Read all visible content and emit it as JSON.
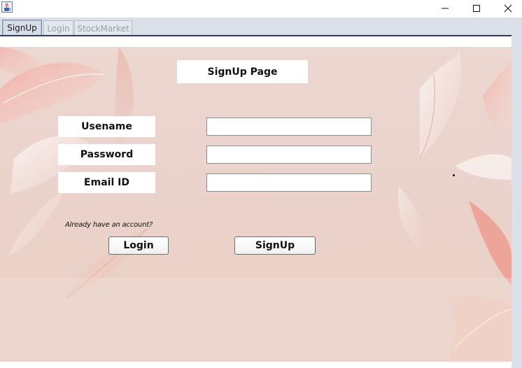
{
  "window": {
    "icon": "java-cup-icon",
    "controls": [
      "minimize-icon",
      "maximize-icon",
      "close-icon"
    ]
  },
  "tabs": [
    {
      "label": "SignUp",
      "active": true
    },
    {
      "label": "Login",
      "active": false
    },
    {
      "label": "StockMarket",
      "active": false
    }
  ],
  "signup": {
    "title": "SignUp Page",
    "username_label": "Usename",
    "password_label": "Password",
    "email_label": "Email ID",
    "username_value": "",
    "password_value": "",
    "email_value": "",
    "hint": "Already have an account?",
    "login_button": "Login",
    "signup_button": "SignUp"
  },
  "colors": {
    "panel_background": "#ecd7d1",
    "feather_accent": "#f0a59a",
    "tab_rule": "#2a3e5c"
  }
}
